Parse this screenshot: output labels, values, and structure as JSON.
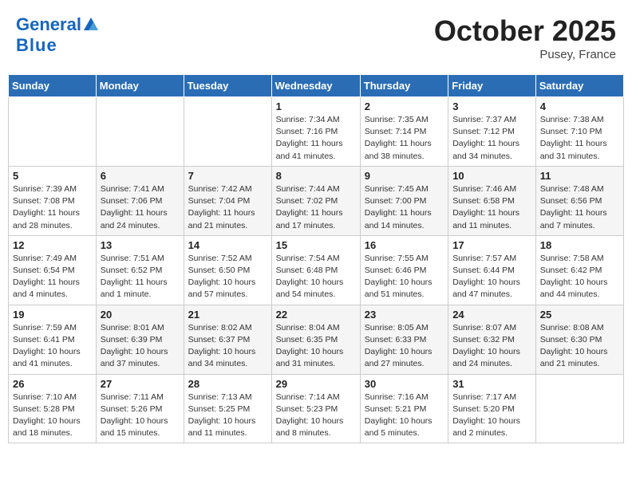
{
  "header": {
    "logo_general": "General",
    "logo_blue": "Blue",
    "month_title": "October 2025",
    "location": "Pusey, France"
  },
  "weekdays": [
    "Sunday",
    "Monday",
    "Tuesday",
    "Wednesday",
    "Thursday",
    "Friday",
    "Saturday"
  ],
  "weeks": [
    [
      {
        "day": "",
        "info": ""
      },
      {
        "day": "",
        "info": ""
      },
      {
        "day": "",
        "info": ""
      },
      {
        "day": "1",
        "info": "Sunrise: 7:34 AM\nSunset: 7:16 PM\nDaylight: 11 hours\nand 41 minutes."
      },
      {
        "day": "2",
        "info": "Sunrise: 7:35 AM\nSunset: 7:14 PM\nDaylight: 11 hours\nand 38 minutes."
      },
      {
        "day": "3",
        "info": "Sunrise: 7:37 AM\nSunset: 7:12 PM\nDaylight: 11 hours\nand 34 minutes."
      },
      {
        "day": "4",
        "info": "Sunrise: 7:38 AM\nSunset: 7:10 PM\nDaylight: 11 hours\nand 31 minutes."
      }
    ],
    [
      {
        "day": "5",
        "info": "Sunrise: 7:39 AM\nSunset: 7:08 PM\nDaylight: 11 hours\nand 28 minutes."
      },
      {
        "day": "6",
        "info": "Sunrise: 7:41 AM\nSunset: 7:06 PM\nDaylight: 11 hours\nand 24 minutes."
      },
      {
        "day": "7",
        "info": "Sunrise: 7:42 AM\nSunset: 7:04 PM\nDaylight: 11 hours\nand 21 minutes."
      },
      {
        "day": "8",
        "info": "Sunrise: 7:44 AM\nSunset: 7:02 PM\nDaylight: 11 hours\nand 17 minutes."
      },
      {
        "day": "9",
        "info": "Sunrise: 7:45 AM\nSunset: 7:00 PM\nDaylight: 11 hours\nand 14 minutes."
      },
      {
        "day": "10",
        "info": "Sunrise: 7:46 AM\nSunset: 6:58 PM\nDaylight: 11 hours\nand 11 minutes."
      },
      {
        "day": "11",
        "info": "Sunrise: 7:48 AM\nSunset: 6:56 PM\nDaylight: 11 hours\nand 7 minutes."
      }
    ],
    [
      {
        "day": "12",
        "info": "Sunrise: 7:49 AM\nSunset: 6:54 PM\nDaylight: 11 hours\nand 4 minutes."
      },
      {
        "day": "13",
        "info": "Sunrise: 7:51 AM\nSunset: 6:52 PM\nDaylight: 11 hours\nand 1 minute."
      },
      {
        "day": "14",
        "info": "Sunrise: 7:52 AM\nSunset: 6:50 PM\nDaylight: 10 hours\nand 57 minutes."
      },
      {
        "day": "15",
        "info": "Sunrise: 7:54 AM\nSunset: 6:48 PM\nDaylight: 10 hours\nand 54 minutes."
      },
      {
        "day": "16",
        "info": "Sunrise: 7:55 AM\nSunset: 6:46 PM\nDaylight: 10 hours\nand 51 minutes."
      },
      {
        "day": "17",
        "info": "Sunrise: 7:57 AM\nSunset: 6:44 PM\nDaylight: 10 hours\nand 47 minutes."
      },
      {
        "day": "18",
        "info": "Sunrise: 7:58 AM\nSunset: 6:42 PM\nDaylight: 10 hours\nand 44 minutes."
      }
    ],
    [
      {
        "day": "19",
        "info": "Sunrise: 7:59 AM\nSunset: 6:41 PM\nDaylight: 10 hours\nand 41 minutes."
      },
      {
        "day": "20",
        "info": "Sunrise: 8:01 AM\nSunset: 6:39 PM\nDaylight: 10 hours\nand 37 minutes."
      },
      {
        "day": "21",
        "info": "Sunrise: 8:02 AM\nSunset: 6:37 PM\nDaylight: 10 hours\nand 34 minutes."
      },
      {
        "day": "22",
        "info": "Sunrise: 8:04 AM\nSunset: 6:35 PM\nDaylight: 10 hours\nand 31 minutes."
      },
      {
        "day": "23",
        "info": "Sunrise: 8:05 AM\nSunset: 6:33 PM\nDaylight: 10 hours\nand 27 minutes."
      },
      {
        "day": "24",
        "info": "Sunrise: 8:07 AM\nSunset: 6:32 PM\nDaylight: 10 hours\nand 24 minutes."
      },
      {
        "day": "25",
        "info": "Sunrise: 8:08 AM\nSunset: 6:30 PM\nDaylight: 10 hours\nand 21 minutes."
      }
    ],
    [
      {
        "day": "26",
        "info": "Sunrise: 7:10 AM\nSunset: 5:28 PM\nDaylight: 10 hours\nand 18 minutes."
      },
      {
        "day": "27",
        "info": "Sunrise: 7:11 AM\nSunset: 5:26 PM\nDaylight: 10 hours\nand 15 minutes."
      },
      {
        "day": "28",
        "info": "Sunrise: 7:13 AM\nSunset: 5:25 PM\nDaylight: 10 hours\nand 11 minutes."
      },
      {
        "day": "29",
        "info": "Sunrise: 7:14 AM\nSunset: 5:23 PM\nDaylight: 10 hours\nand 8 minutes."
      },
      {
        "day": "30",
        "info": "Sunrise: 7:16 AM\nSunset: 5:21 PM\nDaylight: 10 hours\nand 5 minutes."
      },
      {
        "day": "31",
        "info": "Sunrise: 7:17 AM\nSunset: 5:20 PM\nDaylight: 10 hours\nand 2 minutes."
      },
      {
        "day": "",
        "info": ""
      }
    ]
  ]
}
